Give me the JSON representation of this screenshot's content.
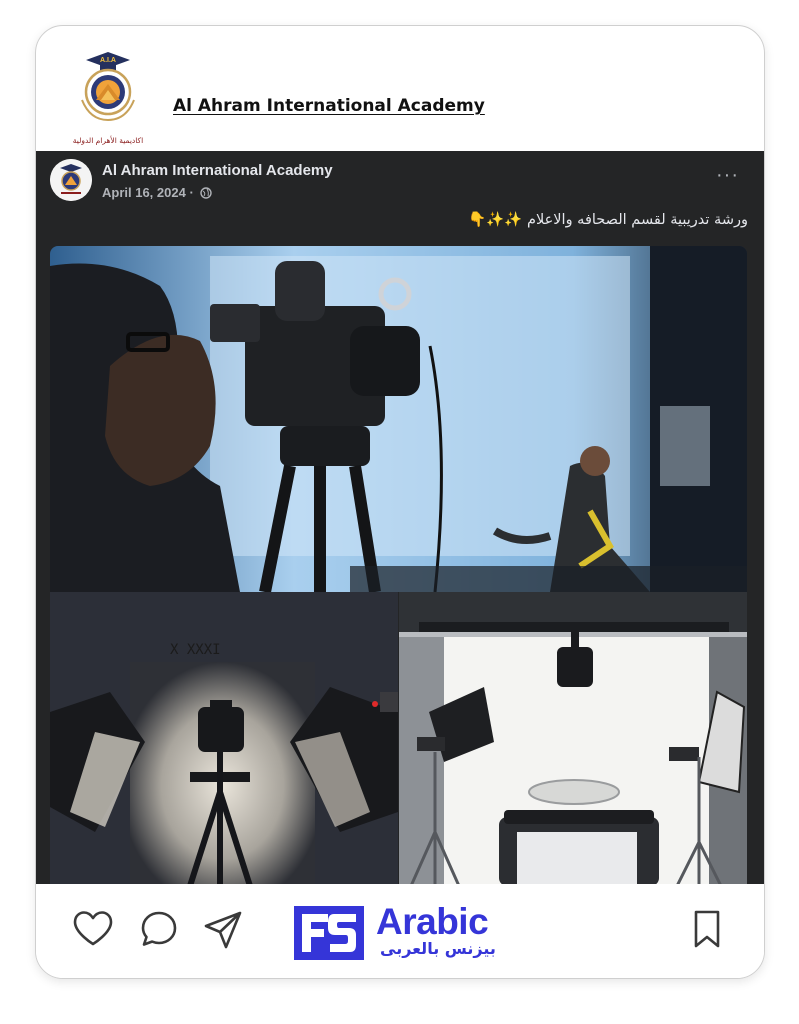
{
  "header": {
    "title": "Al Ahram International Academy",
    "logo_text_top": "A.I.A",
    "logo_text_bottom": "اكاديمية الأهرام الدولية"
  },
  "post": {
    "author": "Al Ahram International Academy",
    "date": "April 16, 2024 ·",
    "more_label": "···",
    "caption": "ورشة تدريبية لقسم الصحافه والاعلام ✨✨👇",
    "photos": [
      {
        "desc": "videographer-camera-photo"
      },
      {
        "desc": "studio-softbox-photo"
      },
      {
        "desc": "white-backdrop-studio-photo"
      }
    ]
  },
  "footer": {
    "actions": [
      "like-icon",
      "comment-icon",
      "share-icon",
      "bookmark-icon"
    ],
    "brand_en": "Arabic",
    "brand_ar": "بيزنس بالعربى"
  },
  "colors": {
    "post_bg": "#242526",
    "brand": "#3535d8",
    "text_light": "#e4e6eb"
  }
}
